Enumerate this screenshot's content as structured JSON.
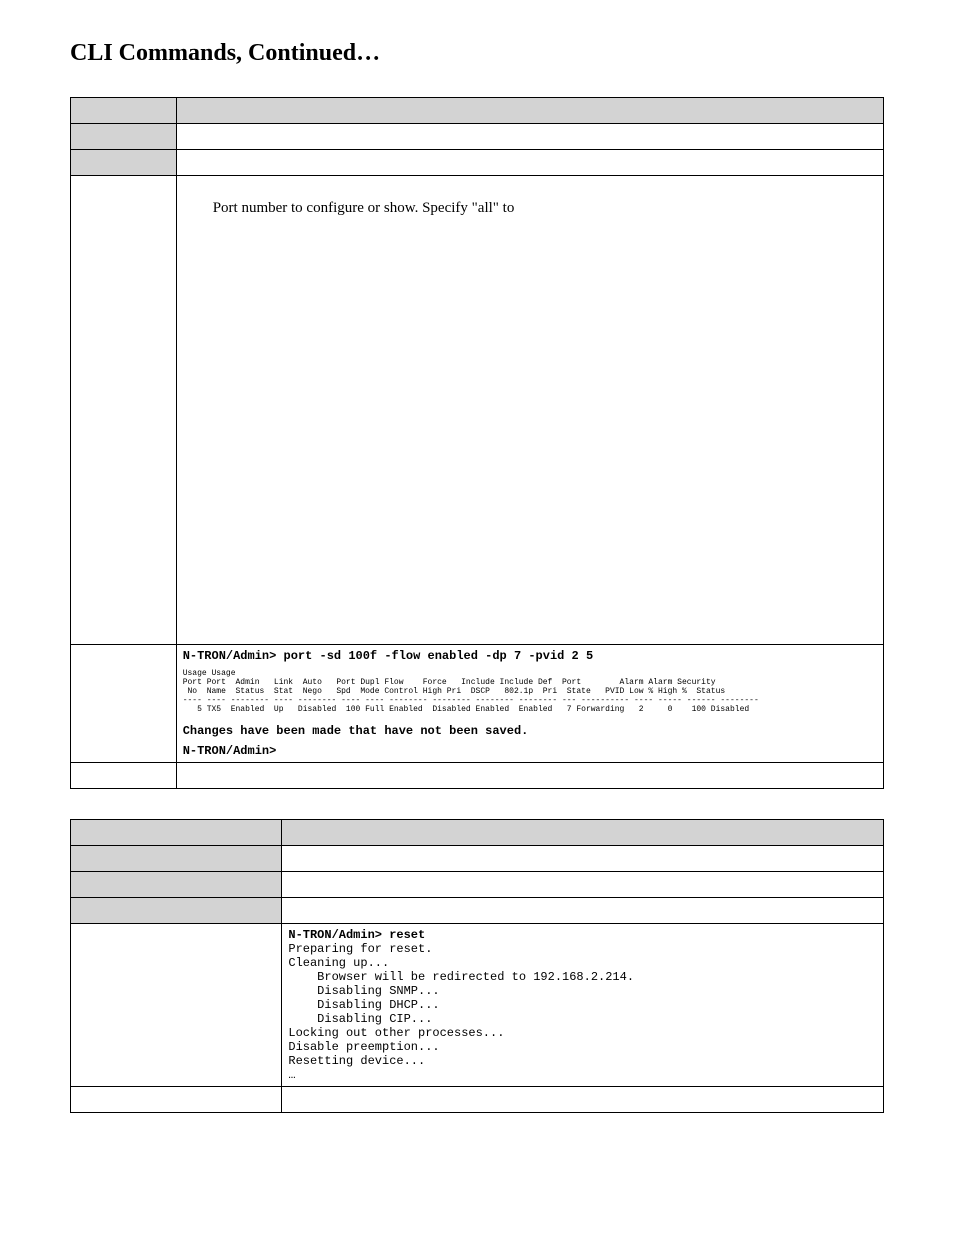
{
  "title": "CLI Commands, Continued…",
  "table1": {
    "param_text": "Port number to configure or show. Specify \"all\" to",
    "cmd_example": "N-TRON/Admin> port -sd 100f -flow enabled -dp 7 -pvid 2 5",
    "usage_header": "Usage Usage\nPort Port  Admin   Link  Auto   Port Dupl Flow    Force   Include Include Def  Port        Alarm Alarm Security\n No  Name  Status  Stat  Nego   Spd  Mode Control High Pri  DSCP   802.1p  Pri  State   PVID Low % High %  Status\n---- ---- -------- ---- -------- ---- ---- -------- -------- -------- -------- --- ---------- ---- ----- ------ --------\n   5 TX5  Enabled  Up   Disabled  100 Full Enabled  Disabled Enabled  Enabled   7 Forwarding   2     0    100 Disabled",
    "changes_msg": "Changes have been made that have not been saved.",
    "prompt": "N-TRON/Admin>"
  },
  "table2": {
    "reset_cmd": "N-TRON/Admin> reset",
    "reset_out": "Preparing for reset.\nCleaning up...\n    Browser will be redirected to 192.168.2.214.\n    Disabling SNMP...\n    Disabling DHCP...\n    Disabling CIP...\nLocking out other processes...\nDisable preemption...\nResetting device...\n…"
  }
}
